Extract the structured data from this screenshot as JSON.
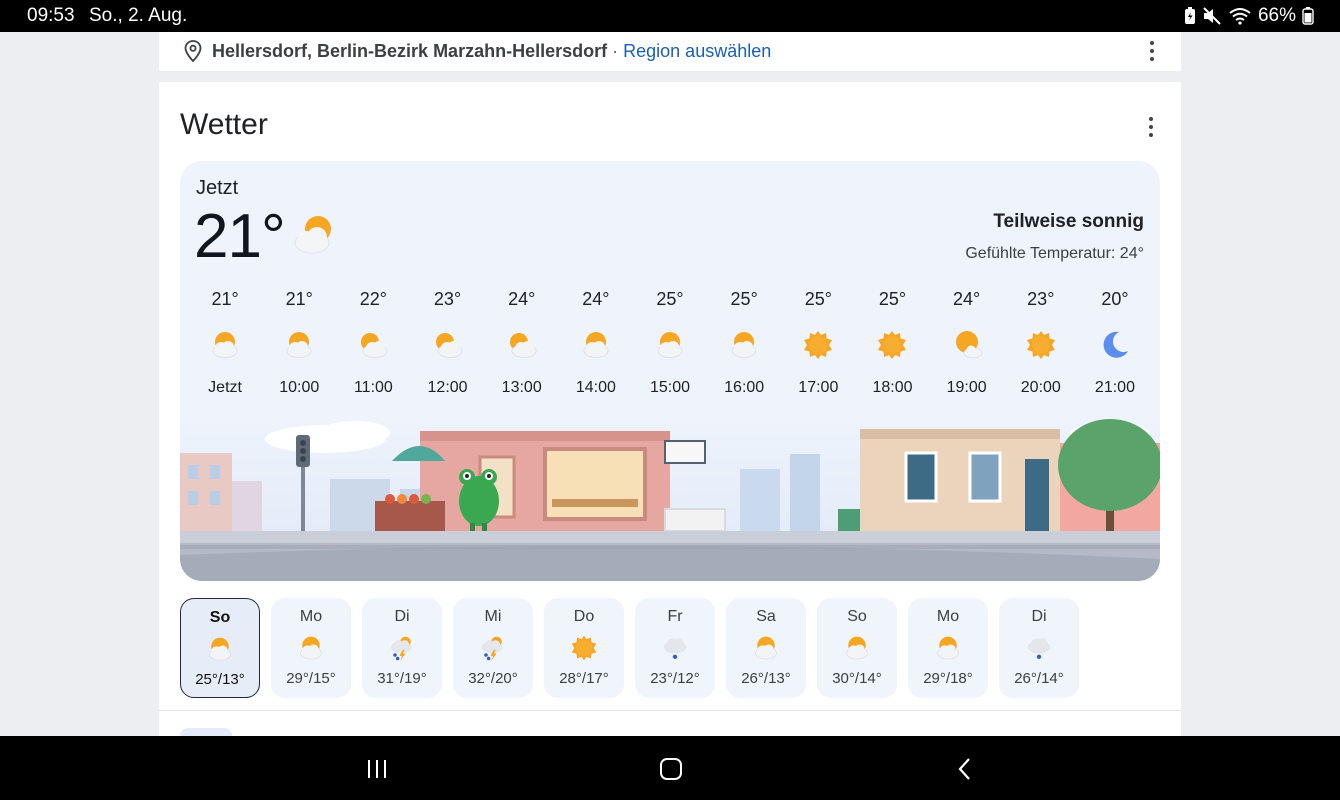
{
  "status_bar": {
    "time": "09:53",
    "date": "So., 2. Aug.",
    "battery": "66%",
    "icons": [
      "battery-saver-icon",
      "mute-icon",
      "wifi-icon",
      "battery-icon"
    ]
  },
  "location": {
    "place": "Hellersdorf, Berlin-Bezirk Marzahn-Hellersdorf",
    "separator": "·",
    "link": "Region auswählen"
  },
  "weather": {
    "title": "Wetter",
    "now_label": "Jetzt",
    "now_temp": "21°",
    "now_icon": "partly-sunny-icon",
    "condition": "Teilweise sonnig",
    "feels_like": "Gefühlte Temperatur: 24°",
    "hourly": [
      {
        "temp": "21°",
        "label": "Jetzt",
        "icon": "partly-sunny"
      },
      {
        "temp": "21°",
        "label": "10:00",
        "icon": "partly-sunny"
      },
      {
        "temp": "22°",
        "label": "11:00",
        "icon": "cloudy-sun"
      },
      {
        "temp": "23°",
        "label": "12:00",
        "icon": "cloudy-sun"
      },
      {
        "temp": "24°",
        "label": "13:00",
        "icon": "cloudy-sun"
      },
      {
        "temp": "24°",
        "label": "14:00",
        "icon": "partly-sunny"
      },
      {
        "temp": "25°",
        "label": "15:00",
        "icon": "partly-sunny"
      },
      {
        "temp": "25°",
        "label": "16:00",
        "icon": "partly-sunny"
      },
      {
        "temp": "25°",
        "label": "17:00",
        "icon": "sunny"
      },
      {
        "temp": "25°",
        "label": "18:00",
        "icon": "sunny"
      },
      {
        "temp": "24°",
        "label": "19:00",
        "icon": "mostly-sunny"
      },
      {
        "temp": "23°",
        "label": "20:00",
        "icon": "sunny"
      },
      {
        "temp": "20°",
        "label": "21:00",
        "icon": "moon"
      }
    ],
    "daily": [
      {
        "day": "So",
        "temps": "25°/13°",
        "icon": "partly-sunny",
        "selected": true
      },
      {
        "day": "Mo",
        "temps": "29°/15°",
        "icon": "partly-sunny",
        "selected": false
      },
      {
        "day": "Di",
        "temps": "31°/19°",
        "icon": "thunderstorm",
        "selected": false
      },
      {
        "day": "Mi",
        "temps": "32°/20°",
        "icon": "thunderstorm",
        "selected": false
      },
      {
        "day": "Do",
        "temps": "28°/17°",
        "icon": "sunny",
        "selected": false
      },
      {
        "day": "Fr",
        "temps": "23°/12°",
        "icon": "rain",
        "selected": false
      },
      {
        "day": "Sa",
        "temps": "26°/13°",
        "icon": "partly-sunny",
        "selected": false
      },
      {
        "day": "So",
        "temps": "30°/14°",
        "icon": "partly-sunny",
        "selected": false
      },
      {
        "day": "Mo",
        "temps": "29°/18°",
        "icon": "partly-sunny",
        "selected": false
      },
      {
        "day": "Di",
        "temps": "26°/14°",
        "icon": "rain",
        "selected": false
      }
    ]
  },
  "colors": {
    "sun": "#f5a623",
    "cloud": "#f3f4f6",
    "moon": "#5b8def",
    "link": "#1a5fb4",
    "hero_bg": "#eef3fc"
  }
}
